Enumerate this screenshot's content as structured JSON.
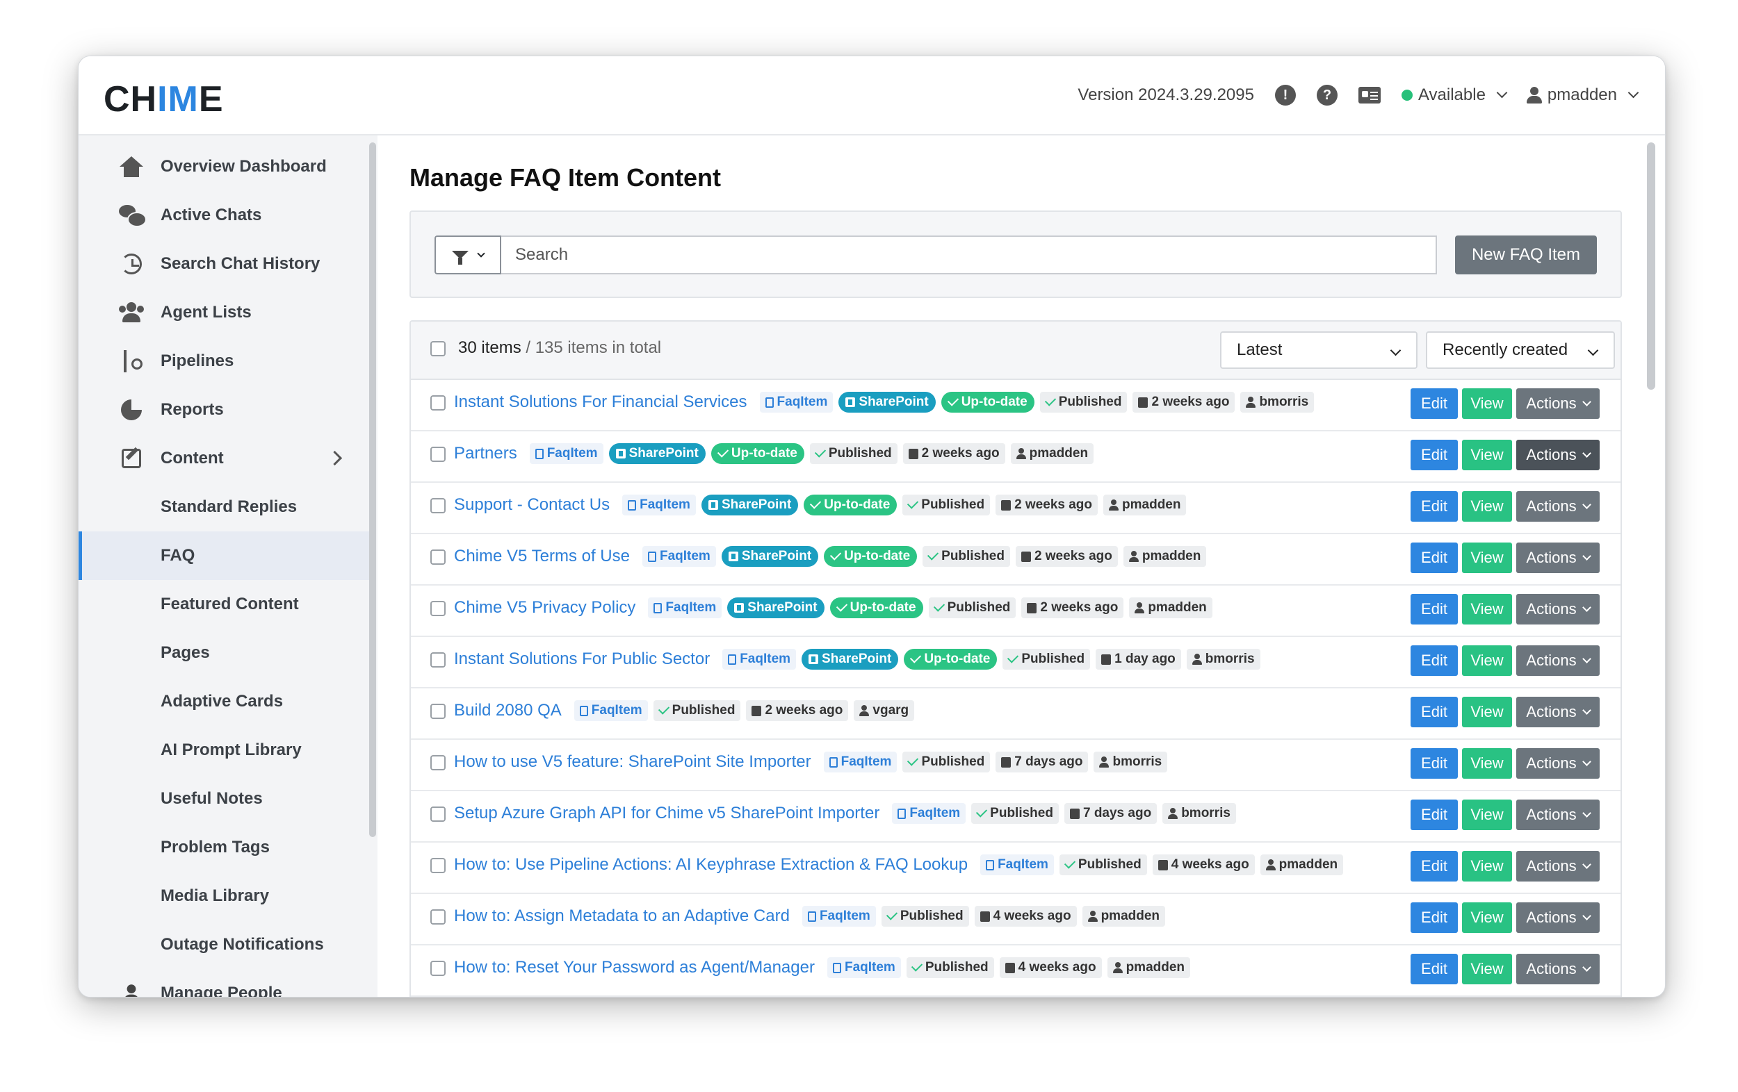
{
  "app": {
    "logo_prefix": "CH",
    "logo_accent": "IM",
    "logo_suffix": "E",
    "version": "Version 2024.3.29.2095",
    "status": "Available",
    "user": "pmadden",
    "accent_color": "#2d86e0"
  },
  "sidebar": {
    "items": [
      {
        "label": "Overview Dashboard",
        "icon": "home-icon"
      },
      {
        "label": "Active Chats",
        "icon": "chat-icon"
      },
      {
        "label": "Search Chat History",
        "icon": "history-icon"
      },
      {
        "label": "Agent Lists",
        "icon": "users-icon"
      },
      {
        "label": "Pipelines",
        "icon": "pipeline-icon"
      },
      {
        "label": "Reports",
        "icon": "pie-chart-icon"
      },
      {
        "label": "Content",
        "icon": "edit-icon"
      }
    ],
    "sub_items": [
      "Standard Replies",
      "FAQ",
      "Featured Content",
      "Pages",
      "Adaptive Cards",
      "AI Prompt Library",
      "Useful Notes",
      "Problem Tags",
      "Media Library",
      "Outage Notifications",
      "Manage People"
    ],
    "active": "FAQ"
  },
  "page": {
    "title": "Manage FAQ Item Content",
    "search_placeholder": "Search",
    "new_button": "New FAQ Item",
    "count_items": "30 items",
    "count_total": " / 135 items in total",
    "sort_version": "Latest",
    "sort_order": "Recently created"
  },
  "buttons": {
    "edit": "Edit",
    "view": "View",
    "actions": "Actions"
  },
  "rows": [
    {
      "title": "Instant Solutions For Financial Services",
      "type": "FaqItem",
      "sharepoint": "SharePoint",
      "sync": "Up-to-date",
      "status": "Published",
      "date": "2 weeks ago",
      "user": "bmorris"
    },
    {
      "title": "Partners",
      "type": "FaqItem",
      "sharepoint": "SharePoint",
      "sync": "Up-to-date",
      "status": "Published",
      "date": "2 weeks ago",
      "user": "pmadden"
    },
    {
      "title": "Support - Contact Us",
      "type": "FaqItem",
      "sharepoint": "SharePoint",
      "sync": "Up-to-date",
      "status": "Published",
      "date": "2 weeks ago",
      "user": "pmadden"
    },
    {
      "title": "Chime V5 Terms of Use",
      "type": "FaqItem",
      "sharepoint": "SharePoint",
      "sync": "Up-to-date",
      "status": "Published",
      "date": "2 weeks ago",
      "user": "pmadden"
    },
    {
      "title": "Chime V5 Privacy Policy",
      "type": "FaqItem",
      "sharepoint": "SharePoint",
      "sync": "Up-to-date",
      "status": "Published",
      "date": "2 weeks ago",
      "user": "pmadden"
    },
    {
      "title": "Instant Solutions For Public Sector",
      "type": "FaqItem",
      "sharepoint": "SharePoint",
      "sync": "Up-to-date",
      "status": "Published",
      "date": "1 day ago",
      "user": "bmorris"
    },
    {
      "title": "Build 2080 QA",
      "type": "FaqItem",
      "status": "Published",
      "date": "2 weeks ago",
      "user": "vgarg"
    },
    {
      "title": "How to use V5 feature: SharePoint Site Importer",
      "type": "FaqItem",
      "status": "Published",
      "date": "7 days ago",
      "user": "bmorris"
    },
    {
      "title": "Setup Azure Graph API for Chime v5 SharePoint Importer",
      "type": "FaqItem",
      "status": "Published",
      "date": "7 days ago",
      "user": "bmorris"
    },
    {
      "title": "How to: Use Pipeline Actions: AI Keyphrase Extraction & FAQ Lookup",
      "type": "FaqItem",
      "status": "Published",
      "date": "4 weeks ago",
      "user": "pmadden"
    },
    {
      "title": "How to: Assign Metadata to an Adaptive Card",
      "type": "FaqItem",
      "status": "Published",
      "date": "4 weeks ago",
      "user": "pmadden"
    },
    {
      "title": "How to: Reset Your Password as Agent/Manager",
      "type": "FaqItem",
      "status": "Published",
      "date": "4 weeks ago",
      "user": "pmadden"
    }
  ]
}
